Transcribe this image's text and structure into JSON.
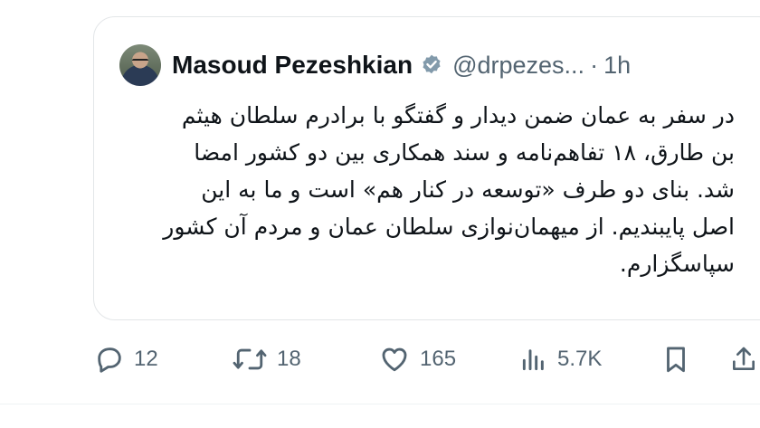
{
  "quote": {
    "author_name": "Masoud Pezeshkian",
    "handle": "@drpezes...",
    "separator": "·",
    "time": "1h",
    "text": "در سفر به عمان ضمن دیدار و گفتگو با برادرم سلطان هیثم بن طارق، ۱۸ تفاهم‌نامه و سند همکاری بین دو کشور امضا شد. بنای دو طرف «توسعه در کنار هم» است و ما به این اصل پایبندیم. از میهمان‌نوازی سلطان عمان و مردم آن کشور سپاسگزارم."
  },
  "actions": {
    "replies": "12",
    "reposts": "18",
    "likes": "165",
    "views": "5.7K"
  },
  "colors": {
    "text": "#0f1419",
    "secondary": "#536471",
    "verified": "#829aab",
    "border": "#e3e6e8"
  },
  "icons": [
    "reply-icon",
    "repost-icon",
    "like-icon",
    "views-icon",
    "bookmark-icon",
    "share-icon",
    "verified-badge-icon"
  ]
}
